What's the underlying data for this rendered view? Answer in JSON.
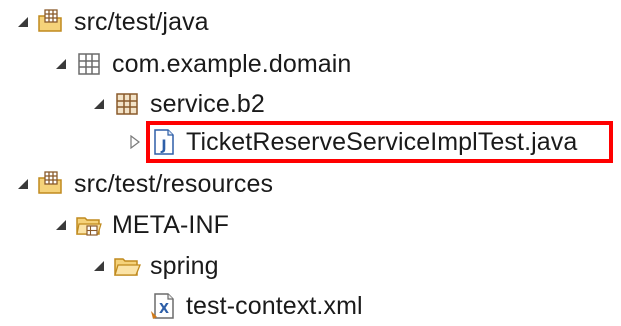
{
  "tree": {
    "items": [
      {
        "label": "src/test/java",
        "icon": "package-folder-icon",
        "expanded": true
      },
      {
        "label": "com.example.domain",
        "icon": "package-icon",
        "expanded": true
      },
      {
        "label": "service.b2",
        "icon": "package-icon",
        "expanded": true
      },
      {
        "label": "TicketReserveServiceImplTest.java",
        "icon": "java-file-icon",
        "expanded": false,
        "selected": true
      },
      {
        "label": "src/test/resources",
        "icon": "package-folder-icon",
        "expanded": true
      },
      {
        "label": "META-INF",
        "icon": "folder-icon",
        "expanded": true
      },
      {
        "label": "spring",
        "icon": "folder-open-icon",
        "expanded": true
      },
      {
        "label": "test-context.xml",
        "icon": "xml-file-icon",
        "expanded": false
      }
    ]
  },
  "colors": {
    "highlight_border": "#ff0000",
    "folder_fill": "#f5d27a",
    "folder_stroke": "#c08a1e",
    "package_stroke": "#8a5a2b",
    "java_blue": "#2e5fa8"
  }
}
